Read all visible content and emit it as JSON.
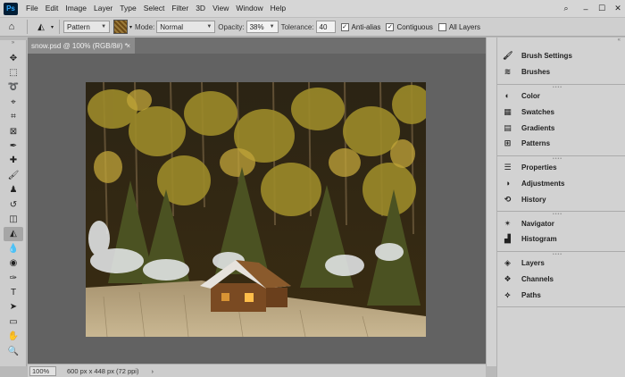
{
  "app": {
    "logo": "Ps"
  },
  "menus": [
    "File",
    "Edit",
    "Image",
    "Layer",
    "Type",
    "Select",
    "Filter",
    "3D",
    "View",
    "Window",
    "Help"
  ],
  "window_controls": {
    "minimize": "–",
    "maximize": "☐",
    "close": "✕"
  },
  "options": {
    "fill_source": "Pattern",
    "mode_label": "Mode:",
    "mode_value": "Normal",
    "opacity_label": "Opacity:",
    "opacity_value": "38%",
    "tolerance_label": "Tolerance:",
    "tolerance_value": "40",
    "anti_alias_label": "Anti-alias",
    "anti_alias_checked": true,
    "contiguous_label": "Contiguous",
    "contiguous_checked": true,
    "all_layers_label": "All Layers",
    "all_layers_checked": false
  },
  "document": {
    "tab_title": "snow.psd @ 100% (RGB/8#) *",
    "close": "×",
    "zoom": "100%",
    "doc_info": "600 px x 448 px (72 ppi)",
    "status_arrow": "›"
  },
  "tools": [
    {
      "name": "move-tool",
      "glyph": "✥"
    },
    {
      "name": "marquee-tool",
      "glyph": "⬚"
    },
    {
      "name": "lasso-tool",
      "glyph": "➰"
    },
    {
      "name": "quick-select-tool",
      "glyph": "⌖"
    },
    {
      "name": "crop-tool",
      "glyph": "⌗"
    },
    {
      "name": "frame-tool",
      "glyph": "⊠"
    },
    {
      "name": "eyedropper-tool",
      "glyph": "✒"
    },
    {
      "name": "spot-heal-tool",
      "glyph": "✚"
    },
    {
      "name": "brush-tool",
      "glyph": "🖌"
    },
    {
      "name": "clone-stamp-tool",
      "glyph": "♟"
    },
    {
      "name": "history-brush-tool",
      "glyph": "↺"
    },
    {
      "name": "eraser-tool",
      "glyph": "◫"
    },
    {
      "name": "paint-bucket-tool",
      "glyph": "◭"
    },
    {
      "name": "blur-tool",
      "glyph": "💧"
    },
    {
      "name": "dodge-tool",
      "glyph": "◉"
    },
    {
      "name": "pen-tool",
      "glyph": "✑"
    },
    {
      "name": "type-tool",
      "glyph": "T"
    },
    {
      "name": "path-select-tool",
      "glyph": "➤"
    },
    {
      "name": "rectangle-tool",
      "glyph": "▭"
    },
    {
      "name": "hand-tool",
      "glyph": "✋"
    },
    {
      "name": "zoom-tool",
      "glyph": "🔍"
    }
  ],
  "panel_groups": [
    [
      {
        "label": "Brush Settings",
        "icon": "brush-settings-icon",
        "glyph": "🖌"
      },
      {
        "label": "Brushes",
        "icon": "brushes-icon",
        "glyph": "≋"
      }
    ],
    [
      {
        "label": "Color",
        "icon": "color-icon",
        "glyph": "◐"
      },
      {
        "label": "Swatches",
        "icon": "swatches-icon",
        "glyph": "▦"
      },
      {
        "label": "Gradients",
        "icon": "gradients-icon",
        "glyph": "▤"
      },
      {
        "label": "Patterns",
        "icon": "patterns-icon",
        "glyph": "⊞"
      }
    ],
    [
      {
        "label": "Properties",
        "icon": "properties-icon",
        "glyph": "☰"
      },
      {
        "label": "Adjustments",
        "icon": "adjustments-icon",
        "glyph": "◑"
      },
      {
        "label": "History",
        "icon": "history-icon",
        "glyph": "⟲"
      }
    ],
    [
      {
        "label": "Navigator",
        "icon": "navigator-icon",
        "glyph": "✴"
      },
      {
        "label": "Histogram",
        "icon": "histogram-icon",
        "glyph": "▟"
      }
    ],
    [
      {
        "label": "Layers",
        "icon": "layers-icon",
        "glyph": "◈"
      },
      {
        "label": "Channels",
        "icon": "channels-icon",
        "glyph": "❖"
      },
      {
        "label": "Paths",
        "icon": "paths-icon",
        "glyph": "⟡"
      }
    ]
  ]
}
